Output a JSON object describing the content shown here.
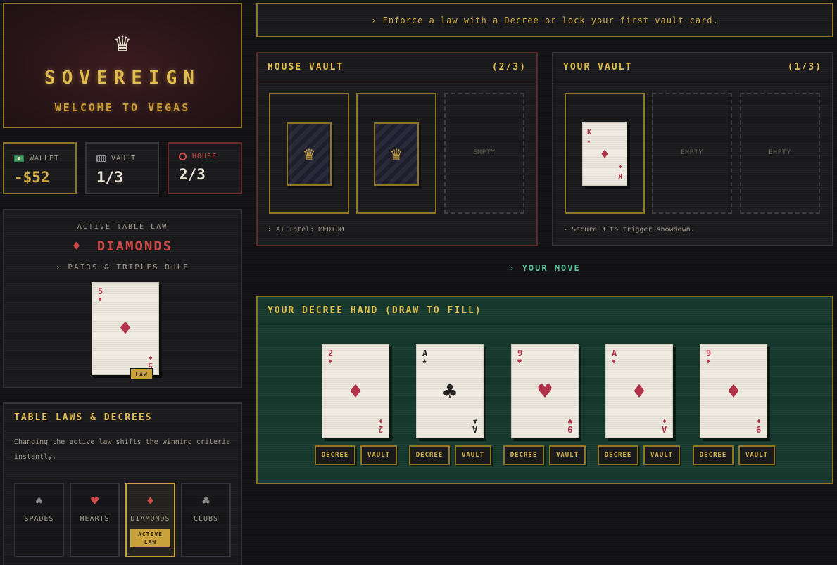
{
  "brand": {
    "crown_icon": "crown-icon",
    "title": "SOVEREIGN",
    "subtitle": "WELCOME TO VEGAS"
  },
  "stats": {
    "wallet": {
      "label": "WALLET",
      "value": "-$52",
      "icon": "cash-icon",
      "color": "#e0bc4c"
    },
    "vault": {
      "label": "VAULT",
      "value": "1/3",
      "icon": "vault-icon"
    },
    "house": {
      "label": "HOUSE",
      "value": "2/3",
      "icon": "circle-icon",
      "color": "#d14a4a"
    }
  },
  "active_law": {
    "heading": "ACTIVE TABLE LAW",
    "suit_symbol": "♦",
    "name": "DIAMONDS",
    "rule": "› PAIRS & TRIPLES RULE",
    "card": {
      "rank": "5",
      "suit": "♦"
    },
    "tag": "LAW"
  },
  "table_laws": {
    "title": "TABLE LAWS & DECREES",
    "description": "Changing the active law shifts the winning criteria instantly.",
    "suits": [
      {
        "symbol": "♠",
        "name": "SPADES",
        "color": "#8a8a8a"
      },
      {
        "symbol": "♥",
        "name": "HEARTS",
        "color": "#d14a4a"
      },
      {
        "symbol": "♦",
        "name": "DIAMONDS",
        "color": "#d14a4a",
        "active_label": "ACTIVE LAW"
      },
      {
        "symbol": "♣",
        "name": "CLUBS",
        "color": "#8a8a8a"
      }
    ]
  },
  "status_message": "› Enforce a law with a Decree or lock your first vault card.",
  "house_vault": {
    "title": "HOUSE VAULT",
    "count": "(2/3)",
    "slots": [
      "facedown",
      "facedown",
      "empty"
    ],
    "empty_label": "EMPTY",
    "footer": "› AI Intel: MEDIUM"
  },
  "your_vault": {
    "title": "YOUR VAULT",
    "count": "(1/3)",
    "card": {
      "rank": "K",
      "suit": "♦"
    },
    "empty_label": "EMPTY",
    "footer": "› Secure 3 to trigger showdown."
  },
  "turn_indicator": "› YOUR MOVE",
  "hand": {
    "title": "YOUR DECREE HAND (DRAW TO FILL)",
    "decree_label": "DECREE",
    "vault_label": "VAULT",
    "cards": [
      {
        "rank": "2",
        "suit": "♦",
        "color": "red"
      },
      {
        "rank": "A",
        "suit": "♣",
        "color": "black"
      },
      {
        "rank": "9",
        "suit": "♥",
        "color": "red"
      },
      {
        "rank": "A",
        "suit": "♦",
        "color": "red"
      },
      {
        "rank": "9",
        "suit": "♦",
        "color": "red"
      }
    ]
  }
}
